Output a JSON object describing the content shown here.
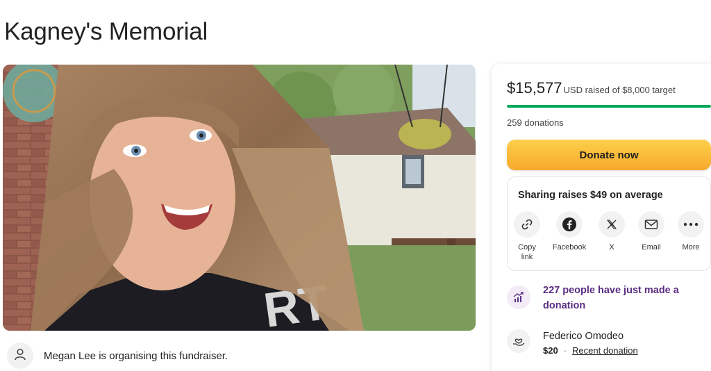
{
  "page": {
    "title": "Kagney's Memorial"
  },
  "organiser": {
    "text": "Megan Lee is organising this fundraiser."
  },
  "stats": {
    "raised_amount": "$15,577",
    "raised_suffix": "USD raised of $8,000 target",
    "progress_fraction": 1.0,
    "donations": "259 donations"
  },
  "donate": {
    "label": "Donate now"
  },
  "share": {
    "title": "Sharing raises $49 on average",
    "options": [
      {
        "label": "Copy link",
        "icon": "link-icon"
      },
      {
        "label": "Facebook",
        "icon": "facebook-icon"
      },
      {
        "label": "X",
        "icon": "x-icon"
      },
      {
        "label": "Email",
        "icon": "email-icon"
      },
      {
        "label": "More",
        "icon": "more-icon"
      }
    ]
  },
  "trend": {
    "text": "227 people have just made a donation"
  },
  "recent": {
    "name": "Federico Omodeo",
    "amount": "$20",
    "label": "Recent donation"
  },
  "colors": {
    "accent_green": "#02a95c",
    "donate_orange": "#f7a92c",
    "trend_purple": "#5a2d82"
  }
}
